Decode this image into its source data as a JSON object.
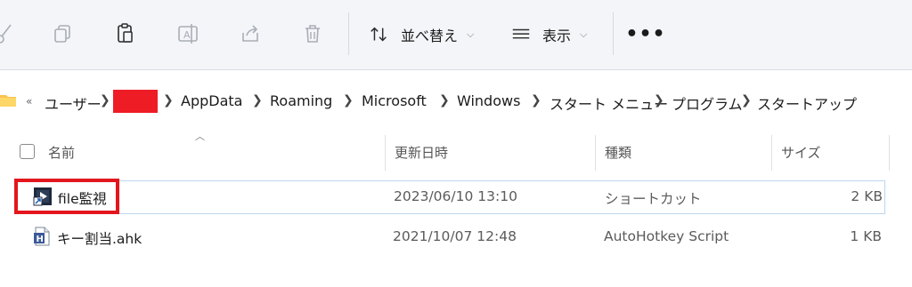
{
  "toolbar": {
    "sort_label": "並べ替え",
    "view_label": "表示",
    "more_label": "•••",
    "icons": [
      "cut-icon",
      "copy-icon",
      "paste-icon",
      "rename-icon",
      "share-icon",
      "delete-icon",
      "sort-icon",
      "view-icon",
      "more-icon"
    ]
  },
  "address": {
    "overflow": "«",
    "crumbs": [
      "ユーザー",
      "AppData",
      "Roaming",
      "Microsoft",
      "Windows",
      "スタート メニュー",
      "プログラム",
      "スタートアップ"
    ],
    "redaction_color": "#ee1c25"
  },
  "columns": {
    "name": "名前",
    "modified": "更新日時",
    "type": "種類",
    "size": "サイズ"
  },
  "files": [
    {
      "name": "file監視",
      "modified": "2023/06/10 13:10",
      "type": "ショートカット",
      "size": "2 KB",
      "icon": "shortcut-icon",
      "selected": true
    },
    {
      "name": "キー割当.ahk",
      "modified": "2021/10/07 12:48",
      "type": "AutoHotkey Script",
      "size": "1 KB",
      "icon": "ahk-file-icon",
      "selected": false
    }
  ],
  "highlight_color": "#e3161d"
}
